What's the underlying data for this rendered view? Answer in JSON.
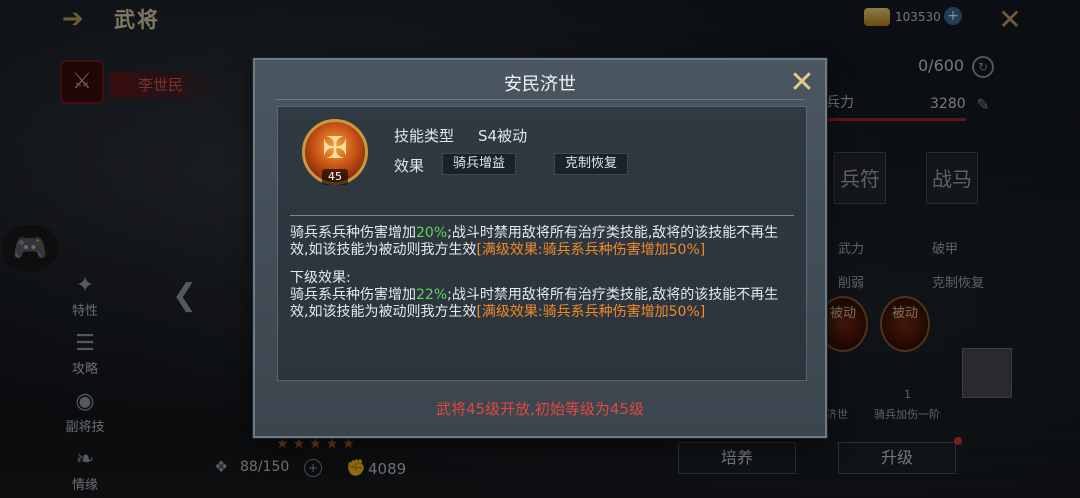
{
  "header": {
    "title": "武将",
    "gold": "103530"
  },
  "general": {
    "name": "李世民"
  },
  "side_nav": [
    {
      "label": "特性",
      "icon": "trait-icon"
    },
    {
      "label": "攻略",
      "icon": "guide-icon"
    },
    {
      "label": "副将技",
      "icon": "deputy-skill-icon"
    },
    {
      "label": "情缘",
      "icon": "bond-icon"
    }
  ],
  "right_panel": {
    "stat_value": "0/600",
    "troops_label": "兵力",
    "troops_value": "3280",
    "slot_1": "兵符",
    "slot_2": "战马",
    "attrs": [
      "武力",
      "破甲",
      "削弱",
      "克制恢复"
    ],
    "skill_1_tag": "被动",
    "skill_1_name": "济世",
    "skill_2_tag": "被动",
    "skill_2_level": "1",
    "skill_2_name": "骑兵加伤一阶"
  },
  "bottom": {
    "exp": "88/150",
    "power": "4089",
    "train_label": "培养",
    "upgrade_label": "升级"
  },
  "modal": {
    "title": "安民济世",
    "skill_level": "45",
    "type_label": "技能类型",
    "type_value": "S4被动",
    "effect_label": "效果",
    "effect_tags": [
      "骑兵增益",
      "克制恢复"
    ],
    "desc1_pre": "骑兵系兵种伤害增加",
    "desc1_pct": "20%",
    "desc1_post": ";战斗时禁用敌将所有治疗类技能,敌将的该技能不再生效,如该技能为被动则我方生效",
    "desc1_max": "[满级效果:骑兵系兵种伤害增加50%]",
    "next_heading": "下级效果:",
    "desc2_pre": "骑兵系兵种伤害增加",
    "desc2_pct": "22%",
    "desc2_post": ";战斗时禁用敌将所有治疗类技能,敌将的该技能不再生效,如该技能为被动则我方生效",
    "desc2_max": "[满级效果:骑兵系兵种伤害增加50%]",
    "unlock_note": "武将45级开放,初始等级为45级"
  },
  "colors": {
    "accent_gold": "#c9a765",
    "highlight_green": "#5fd35a",
    "highlight_orange": "#f08b2a",
    "warning_red": "#e2463f"
  }
}
